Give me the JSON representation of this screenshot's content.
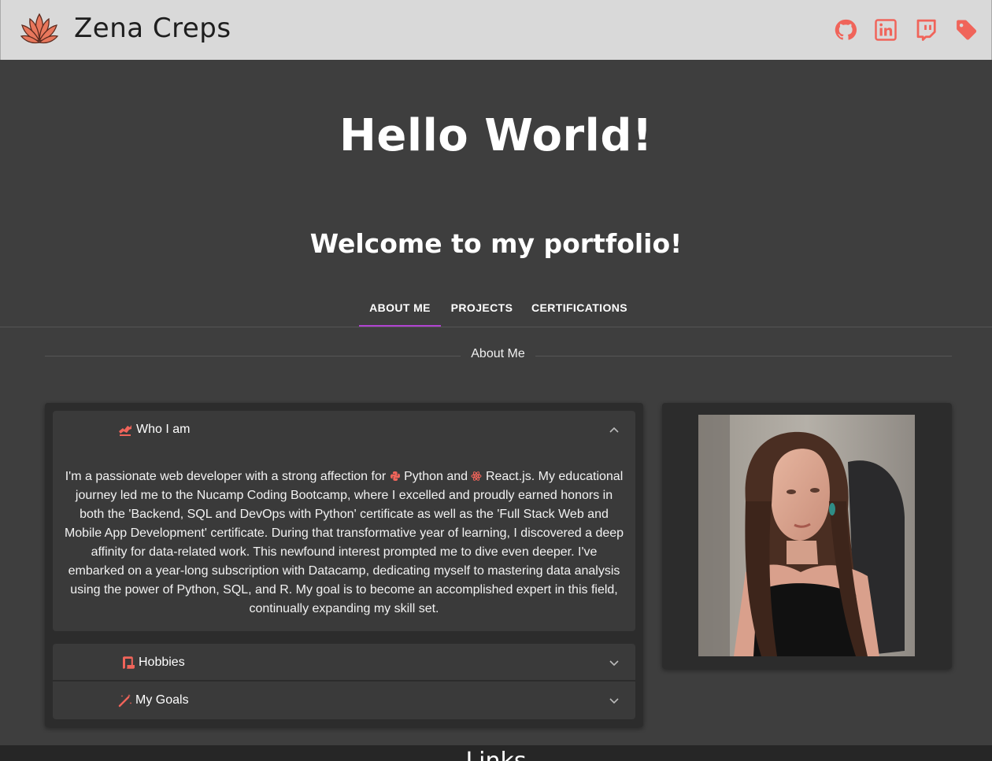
{
  "header": {
    "brand": "Zena Creps",
    "logo_icon": "lotus-icon",
    "social": [
      {
        "name": "github",
        "icon": "github-icon"
      },
      {
        "name": "linkedin",
        "icon": "linkedin-icon"
      },
      {
        "name": "twitch",
        "icon": "twitch-icon"
      },
      {
        "name": "tag",
        "icon": "tag-icon"
      }
    ],
    "icon_color": "#f0645a"
  },
  "hero": {
    "title": "Hello World!",
    "subtitle": "Welcome to my portfolio!"
  },
  "tabs": [
    {
      "label": "ABOUT ME",
      "active": true
    },
    {
      "label": "PROJECTS",
      "active": false
    },
    {
      "label": "CERTIFICATIONS",
      "active": false
    }
  ],
  "section": {
    "label": "About Me"
  },
  "accordion": [
    {
      "title": "Who I am",
      "icon": "dragon-icon",
      "expanded": true,
      "body": {
        "part1": "I'm a passionate web developer with a strong affection for ",
        "python_label": "Python",
        "part2": " and ",
        "react_label": "React.js",
        "part3": ". My educational journey led me to the Nucamp Coding Bootcamp, where I excelled and proudly earned honors in both the 'Backend, SQL and DevOps with Python' certificate as well as the 'Full Stack Web and Mobile App Development' certificate. During that transformative year of learning, I discovered a deep affinity for data-related work. This newfound interest prompted me to dive even deeper. I've embarked on a year-long subscription with Datacamp, dedicating myself to mastering data analysis using the power of Python, SQL, and R. My goal is to become an accomplished expert in this field, continually expanding my skill set."
      }
    },
    {
      "title": "Hobbies",
      "icon": "scroll-icon",
      "expanded": false
    },
    {
      "title": "My Goals",
      "icon": "magic-wand-icon",
      "expanded": false
    }
  ],
  "photo": {
    "icon": "portrait-photo"
  },
  "footer": {
    "title": "Links"
  },
  "colors": {
    "accent": "#f0645a",
    "tab_indicator": "#b043d1",
    "background": "#3e3e3e",
    "appbar": "#d9d9d9"
  }
}
